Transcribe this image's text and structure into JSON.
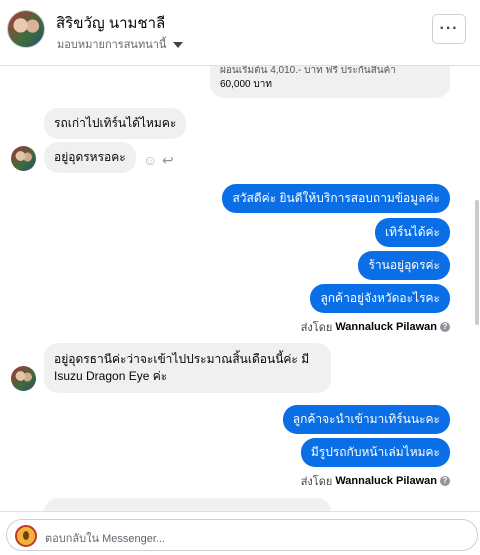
{
  "header": {
    "contact_name": "สิริขวัญ นามชาลี",
    "assign_label": "มอบหมายการสนทนานี้",
    "more_label": "···"
  },
  "thread": {
    "truncated_message": {
      "line1": "ผ่อนเริ่มต้น 4,010.- บาท ฟรี ประกันสินค้า",
      "line2": "60,000 บาท"
    },
    "incoming_1": "รถเก่าไปเทิร์นได้ไหมคะ",
    "incoming_2": "อยู่อุดรหรอคะ",
    "outgoing_group_1": [
      "สวัสดีค่ะ  ยินดีให้บริการสอบถามข้อมูลค่ะ",
      "เทิร์นได้ค่ะ",
      "ร้านอยู่อุดรค่ะ",
      "ลูกค้าอยู่จังหวัดอะไรคะ"
    ],
    "sent_by_1": {
      "prefix": "ส่งโดย",
      "name": "Wannaluck Pilawan"
    },
    "incoming_3": {
      "line1": "อยู่อุดรธานีค่ะว่าจะเข้าไปประมาณสิ้นเดือนนี้ค่ะ มี",
      "line2": "Isuzu Dragon Eye ค่ะ"
    },
    "outgoing_group_2": [
      "ลูกค้าจะนำเข้ามาเทิร์นนะคะ",
      "มีรูปรถกับหน้าเล่มไหมคะ"
    ],
    "sent_by_2": {
      "prefix": "ส่งโดย",
      "name": "Wannaluck Pilawan"
    }
  },
  "footer": {
    "reply_placeholder": "ตอบกลับใน Messenger..."
  }
}
